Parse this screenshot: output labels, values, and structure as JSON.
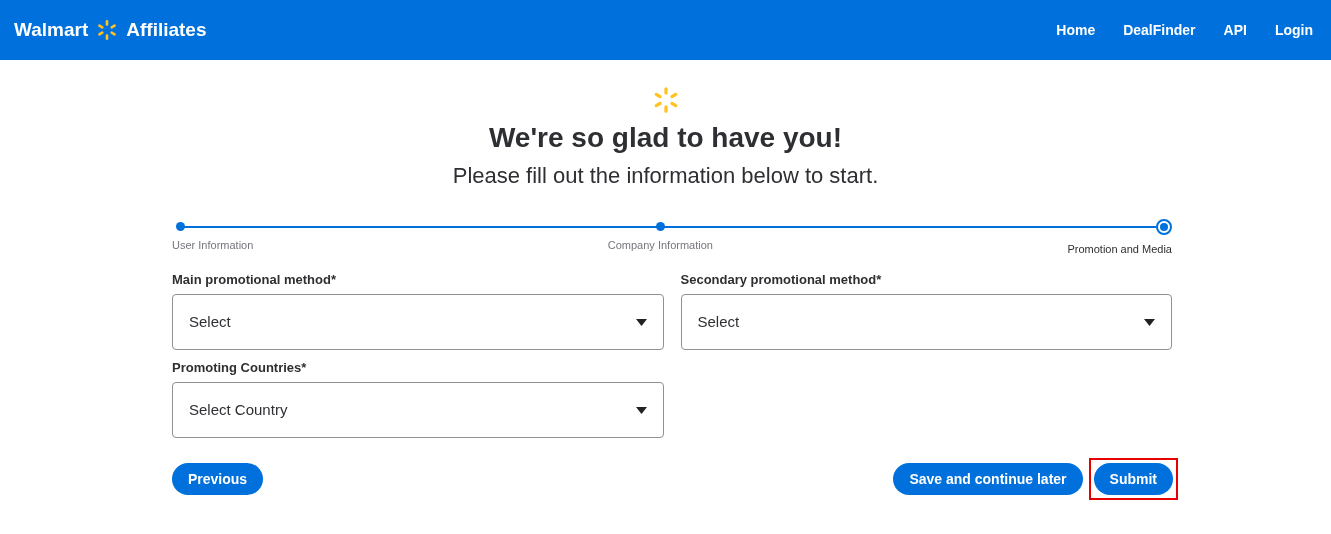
{
  "header": {
    "brand_left": "Walmart",
    "brand_right": "Affiliates",
    "nav": [
      {
        "label": "Home"
      },
      {
        "label": "DealFinder"
      },
      {
        "label": "API"
      },
      {
        "label": "Login"
      }
    ]
  },
  "intro": {
    "title": "We're so glad to have you!",
    "subtitle": "Please fill out the information below to start."
  },
  "steps": [
    {
      "label": "User Information",
      "selected": false
    },
    {
      "label": "Company Information",
      "selected": false
    },
    {
      "label": "Promotion and Media",
      "selected": true
    }
  ],
  "fields": [
    {
      "label": "Main promotional method*",
      "value": "Select"
    },
    {
      "label": "Secondary promotional method*",
      "value": "Select"
    },
    {
      "label": "Promoting Countries*",
      "value": "Select Country"
    }
  ],
  "buttons": {
    "previous": {
      "label": "Previous",
      "highlighted": false
    },
    "save": {
      "label": "Save and continue later",
      "highlighted": false
    },
    "submit": {
      "label": "Submit",
      "highlighted": true
    }
  }
}
